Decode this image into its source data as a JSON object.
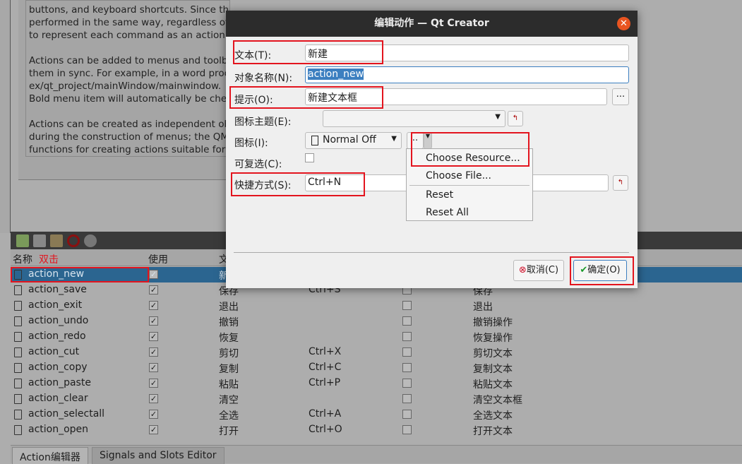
{
  "doc": {
    "paragraphs": [
      "buttons, and keyboard shortcuts. Since the user expects each command to be performed in the same way, regardless of the user interface used, it is useful to represent each command as an action.",
      "Actions can be added to menus and toolbars, and will automatically keep them in sync. For example, in a word processor, if the user presses a ex/qt_project/mainWindow/mainwindow... Bold menu item will automatically be checked.",
      "Actions can be created as independent objects, but they may also be created during the construction of menus; the QMenu class contains convenience functions for creating actions suitable for"
    ],
    "lines": [
      "buttons, and keyboard shortcuts. Since the user expects each command to be",
      "performed in the same way, regardless of the user interface used, it is useful",
      "to represent each command as an action.",
      "Actions can be added to menus and toolb",
      "them in sync. For example, in a word proc",
      "ex/qt_project/mainWindow/mainwindow.",
      "Bold menu item will automatically be che",
      "Actions can be created as independent ob",
      "during the construction of menus; the QM",
      "functions for creating actions suitable for"
    ]
  },
  "toolbar": {
    "icons": [
      "new-action-icon",
      "copy-icon",
      "paste-icon",
      "delete-icon",
      "settings-icon"
    ]
  },
  "table": {
    "headers": {
      "name": "名称",
      "annotation": "双击",
      "used": "使用",
      "text": "文"
    },
    "rows": [
      {
        "name": "action_new",
        "icon": "file-new-icon",
        "used": true,
        "text": "新",
        "shortcut": "",
        "checkable": false,
        "tooltip": ""
      },
      {
        "name": "action_save",
        "icon": "save-icon",
        "used": true,
        "text": "保存",
        "shortcut": "Ctrl+S",
        "checkable": false,
        "tooltip": "保存"
      },
      {
        "name": "action_exit",
        "icon": "exit-icon",
        "used": true,
        "text": "退出",
        "shortcut": "",
        "checkable": false,
        "tooltip": "退出"
      },
      {
        "name": "action_undo",
        "icon": "undo-icon",
        "used": true,
        "text": "撤销",
        "shortcut": "",
        "checkable": false,
        "tooltip": "撤销操作"
      },
      {
        "name": "action_redo",
        "icon": "redo-icon",
        "used": true,
        "text": "恢复",
        "shortcut": "",
        "checkable": false,
        "tooltip": "恢复操作"
      },
      {
        "name": "action_cut",
        "icon": "cut-icon",
        "used": true,
        "text": "剪切",
        "shortcut": "Ctrl+X",
        "checkable": false,
        "tooltip": "剪切文本"
      },
      {
        "name": "action_copy",
        "icon": "copy-icon",
        "used": true,
        "text": "复制",
        "shortcut": "Ctrl+C",
        "checkable": false,
        "tooltip": "复制文本"
      },
      {
        "name": "action_paste",
        "icon": "paste-icon",
        "used": true,
        "text": "粘贴",
        "shortcut": "Ctrl+P",
        "checkable": false,
        "tooltip": "粘贴文本"
      },
      {
        "name": "action_clear",
        "icon": "clear-icon",
        "used": true,
        "text": "清空",
        "shortcut": "",
        "checkable": false,
        "tooltip": "清空文本框"
      },
      {
        "name": "action_selectall",
        "icon": "select-all-icon",
        "used": true,
        "text": "全选",
        "shortcut": "Ctrl+A",
        "checkable": false,
        "tooltip": "全选文本"
      },
      {
        "name": "action_open",
        "icon": "open-icon",
        "used": true,
        "text": "打开",
        "shortcut": "Ctrl+O",
        "checkable": false,
        "tooltip": "打开文本"
      }
    ]
  },
  "tabs": [
    "Action编辑器",
    "Signals and Slots Editor"
  ],
  "dialog": {
    "title": "编辑动作 — Qt Creator",
    "text_label": "文本(T):",
    "text_value": "新建",
    "objname_label": "对象名称(N):",
    "objname_value": "action_new",
    "tooltip_label": "提示(O):",
    "tooltip_value": "新建文本框",
    "tooltip_more": "...",
    "theme_label": "图标主题(E):",
    "theme_value": "",
    "icon_label": "图标(I):",
    "icon_mode": "Normal Off",
    "icon_button": "..",
    "checkable_label": "可复选(C):",
    "checkable": false,
    "shortcut_label": "快捷方式(S):",
    "shortcut_value": "Ctrl+N",
    "cancel": "取消(C)",
    "ok": "确定(O)",
    "menu": [
      "Choose Resource...",
      "Choose File...",
      "Reset",
      "Reset All"
    ],
    "accent": "#e95420"
  }
}
